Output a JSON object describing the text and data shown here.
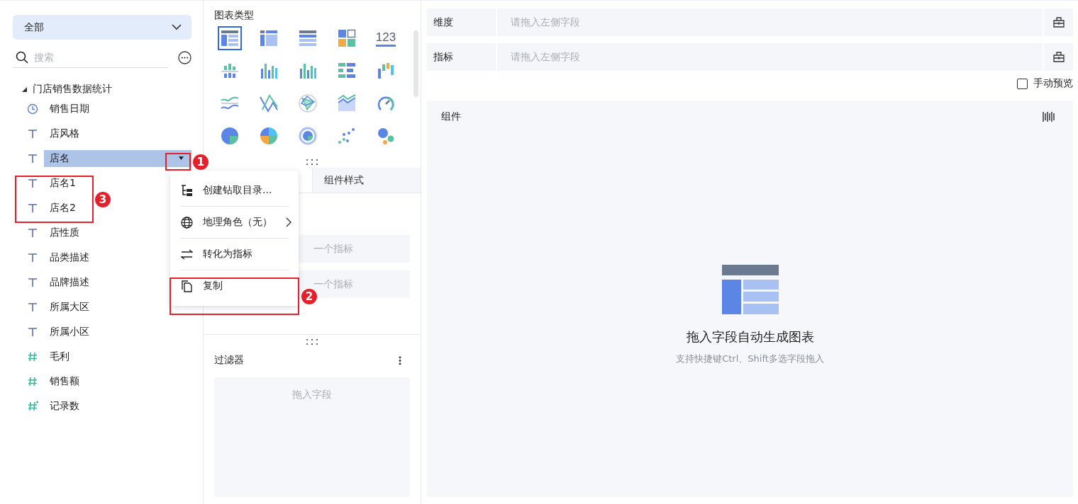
{
  "left_panel": {
    "dropdown": {
      "value": "全部"
    },
    "search": {
      "placeholder": "搜索"
    },
    "tree": {
      "label": "门店销售数据统计",
      "expanded": true,
      "children": [
        {
          "label": "销售日期",
          "kind": "date",
          "selected": false
        },
        {
          "label": "店风格",
          "kind": "text",
          "selected": false
        },
        {
          "label": "店名",
          "kind": "text",
          "selected": true
        },
        {
          "label": "店名1",
          "kind": "text",
          "selected": false
        },
        {
          "label": "店名2",
          "kind": "text",
          "selected": false
        },
        {
          "label": "店性质",
          "kind": "text",
          "selected": false
        },
        {
          "label": "品类描述",
          "kind": "text",
          "selected": false
        },
        {
          "label": "品牌描述",
          "kind": "text",
          "selected": false
        },
        {
          "label": "所属大区",
          "kind": "text",
          "selected": false
        },
        {
          "label": "所属小区",
          "kind": "text",
          "selected": false
        },
        {
          "label": "毛利",
          "kind": "number",
          "selected": false
        },
        {
          "label": "销售额",
          "kind": "number",
          "selected": false
        },
        {
          "label": "记录数",
          "kind": "count",
          "selected": false
        }
      ]
    }
  },
  "middle_panel": {
    "chart_types_title": "图表类型",
    "chart_types": [
      {
        "kind": "table-detail",
        "selected": true
      },
      {
        "kind": "table-cross",
        "selected": false
      },
      {
        "kind": "table-group",
        "selected": false
      },
      {
        "kind": "kpi",
        "selected": false
      },
      {
        "kind": "number",
        "text": "123",
        "selected": false
      },
      {
        "kind": "bar-grouped",
        "selected": false
      },
      {
        "kind": "bar-multi",
        "selected": false
      },
      {
        "kind": "bar",
        "selected": false
      },
      {
        "kind": "bar-horizontal",
        "selected": false
      },
      {
        "kind": "waterfall",
        "selected": false
      },
      {
        "kind": "line",
        "selected": false
      },
      {
        "kind": "line-cross",
        "selected": false
      },
      {
        "kind": "radar",
        "selected": false
      },
      {
        "kind": "area",
        "selected": false
      },
      {
        "kind": "gauge",
        "selected": false
      },
      {
        "kind": "pie",
        "selected": false
      },
      {
        "kind": "pie-multi",
        "selected": false
      },
      {
        "kind": "donut",
        "selected": false
      },
      {
        "kind": "scatter",
        "selected": false
      },
      {
        "kind": "bubble",
        "selected": false
      }
    ],
    "tabs": [
      {
        "label": "组件样式",
        "selected": false
      }
    ],
    "drop_zones": [
      "一个指标",
      "一个指标"
    ],
    "filter": {
      "title": "过滤器",
      "placeholder": "拖入字段"
    }
  },
  "context_menu": {
    "items": [
      {
        "label": "创建钻取目录...",
        "kind": "tree",
        "submenu": false
      },
      {
        "label": "地理角色（无）",
        "kind": "globe",
        "submenu": true
      },
      {
        "label": "转化为指标",
        "kind": "swap",
        "submenu": false
      },
      {
        "label": "复制",
        "kind": "copy",
        "submenu": false
      }
    ]
  },
  "right_panel": {
    "rows": [
      {
        "label": "维度",
        "placeholder": "请拖入左侧字段"
      },
      {
        "label": "指标",
        "placeholder": "请拖入左侧字段"
      }
    ],
    "manual_preview": {
      "label": "手动预览",
      "checked": false
    },
    "component": {
      "title": "组件",
      "empty_title": "拖入字段自动生成图表",
      "empty_hint": "支持快捷键Ctrl、Shift多选字段拖入"
    }
  },
  "annotations": [
    "1",
    "2",
    "3"
  ]
}
